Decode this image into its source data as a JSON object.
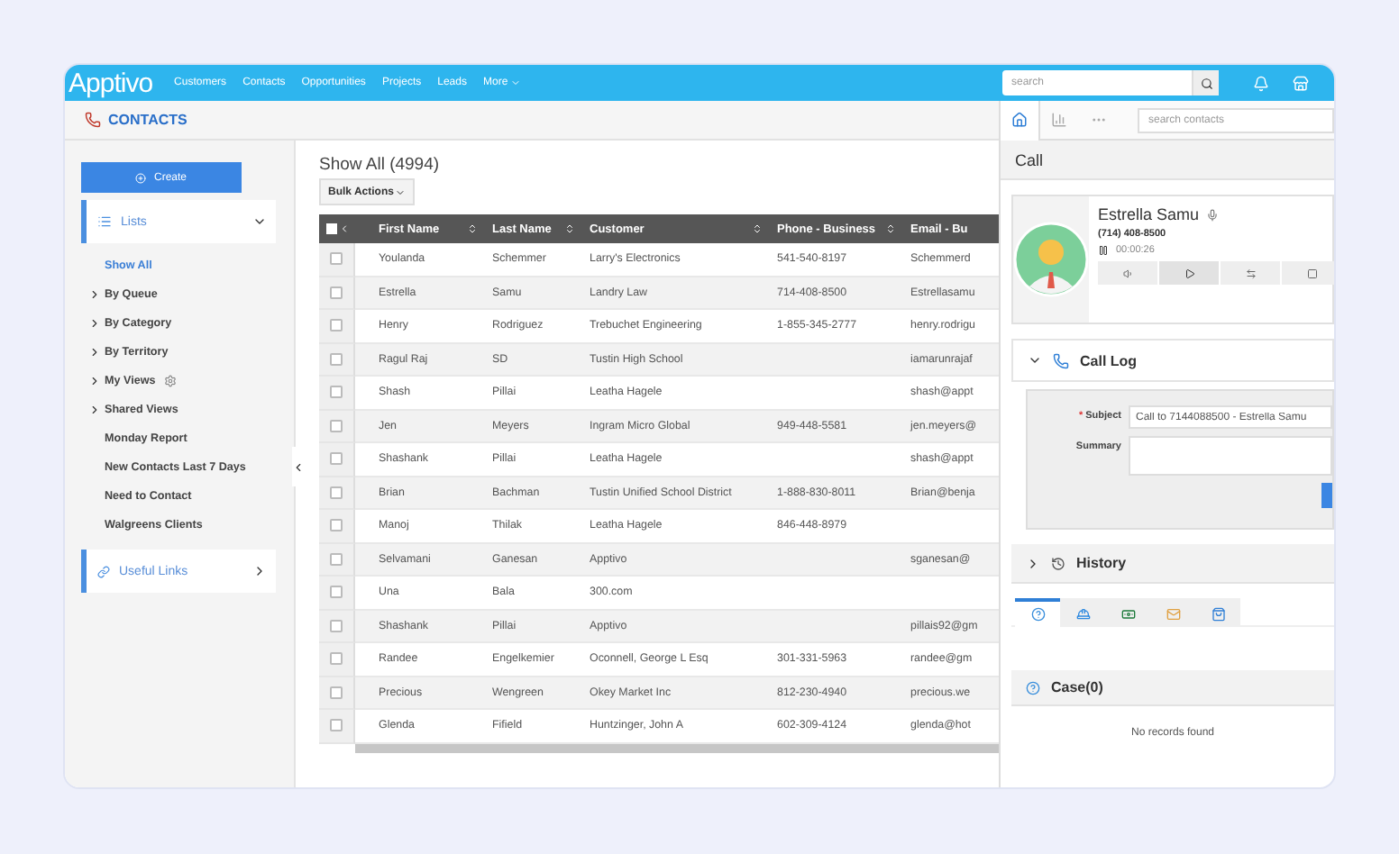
{
  "nav": {
    "logo": "Apptivo",
    "items": [
      "Customers",
      "Contacts",
      "Opportunities",
      "Projects",
      "Leads",
      "More"
    ],
    "search": {
      "placeholder": "search"
    }
  },
  "header": {
    "title": "CONTACTS"
  },
  "sidebar": {
    "create": "Create",
    "lists": {
      "label": "Lists",
      "expanded": true
    },
    "items": [
      {
        "label": "Show All",
        "kind": "link",
        "selected": true
      },
      {
        "label": "By Queue",
        "kind": "group",
        "selected": false
      },
      {
        "label": "By Category",
        "kind": "group",
        "selected": false
      },
      {
        "label": "By Territory",
        "kind": "group",
        "selected": false
      },
      {
        "label": "My Views",
        "kind": "group",
        "selected": false,
        "settings": true
      },
      {
        "label": "Shared Views",
        "kind": "group",
        "selected": false
      },
      {
        "label": "Monday Report",
        "kind": "link",
        "selected": false
      },
      {
        "label": "New Contacts Last 7 Days",
        "kind": "link",
        "selected": false
      },
      {
        "label": "Need to Contact",
        "kind": "link",
        "selected": false
      },
      {
        "label": "Walgreens Clients",
        "kind": "link",
        "selected": false
      }
    ],
    "useful_links": {
      "label": "Useful Links",
      "expanded": false
    }
  },
  "main": {
    "title": "Show All (4994)",
    "bulk_actions": "Bulk Actions",
    "select_all": {
      "checked": false
    },
    "columns": [
      "First Name",
      "Last Name",
      "Customer",
      "Phone - Business",
      "Email - Bu"
    ],
    "rows": [
      {
        "checked": false,
        "cells": [
          "Youlanda",
          "Schemmer",
          "Larry's Electronics",
          "541-540-8197",
          "Schemmerd"
        ]
      },
      {
        "checked": false,
        "cells": [
          "Estrella",
          "Samu",
          "Landry Law",
          "714-408-8500",
          "Estrellasamu"
        ]
      },
      {
        "checked": false,
        "cells": [
          "Henry",
          "Rodriguez",
          "Trebuchet Engineering",
          "1-855-345-2777",
          "henry.rodrigu"
        ]
      },
      {
        "checked": false,
        "cells": [
          "Ragul Raj",
          "SD",
          "Tustin High School",
          "",
          "iamarunrajaf"
        ]
      },
      {
        "checked": false,
        "cells": [
          "Shash",
          "Pillai",
          "Leatha Hagele",
          "",
          "shash@appt"
        ]
      },
      {
        "checked": false,
        "cells": [
          "Jen",
          "Meyers",
          "Ingram Micro Global",
          "949-448-5581",
          "jen.meyers@"
        ]
      },
      {
        "checked": false,
        "cells": [
          "Shashank",
          "Pillai",
          "Leatha Hagele",
          "",
          "shash@appt"
        ]
      },
      {
        "checked": false,
        "cells": [
          "Brian",
          "Bachman",
          "Tustin Unified School District",
          "1-888-830-8011",
          "Brian@benja"
        ]
      },
      {
        "checked": false,
        "cells": [
          "Manoj",
          "Thilak",
          "Leatha Hagele",
          "846-448-8979",
          ""
        ]
      },
      {
        "checked": false,
        "cells": [
          "Selvamani",
          "Ganesan",
          "Apptivo",
          "",
          "sganesan@"
        ]
      },
      {
        "checked": false,
        "cells": [
          "Una",
          "Bala",
          "300.com",
          "",
          ""
        ]
      },
      {
        "checked": false,
        "cells": [
          "Shashank",
          "Pillai",
          "Apptivo",
          "",
          "pillais92@gm"
        ]
      },
      {
        "checked": false,
        "cells": [
          "Randee",
          "Engelkemier",
          "Oconnell, George L Esq",
          "301-331-5963",
          "randee@gm"
        ]
      },
      {
        "checked": false,
        "cells": [
          "Precious",
          "Wengreen",
          "Okey Market Inc",
          "812-230-4940",
          "precious.we"
        ]
      },
      {
        "checked": false,
        "cells": [
          "Glenda",
          "Fifield",
          "Huntzinger, John A",
          "602-309-4124",
          "glenda@hot"
        ]
      }
    ]
  },
  "panel": {
    "tabs": [
      {
        "kind": "home",
        "selected": true
      },
      {
        "kind": "chart",
        "selected": false
      },
      {
        "kind": "more",
        "selected": false
      }
    ],
    "search": {
      "placeholder": "search contacts"
    },
    "call": {
      "title": "Call",
      "name": "Estrella Samu",
      "phone": "(714) 408-8500",
      "timer": "00:00:26"
    },
    "call_log": {
      "title": "Call Log",
      "expanded": true,
      "subject_required_mark": "*",
      "subject_label": "Subject",
      "subject": "Call to 7144088500 - Estrella Samu",
      "summary_label": "Summary"
    },
    "history": {
      "title": "History",
      "expanded": false
    },
    "related_tabs": [
      {
        "kind": "case",
        "selected": true
      },
      {
        "kind": "lead",
        "selected": false
      },
      {
        "kind": "money",
        "selected": false
      },
      {
        "kind": "mail",
        "selected": false
      },
      {
        "kind": "bag",
        "selected": false
      }
    ],
    "case": {
      "title": "Case(0)",
      "empty": "No records found"
    }
  }
}
